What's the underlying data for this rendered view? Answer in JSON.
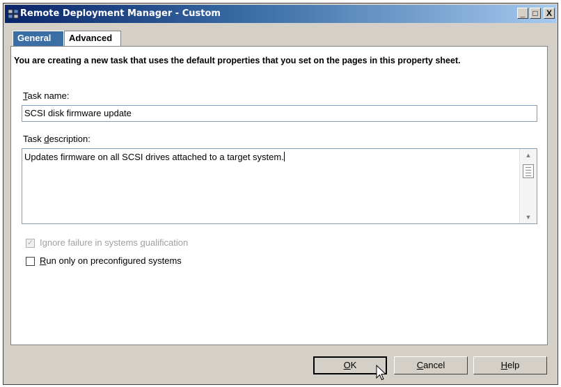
{
  "window": {
    "title": "Remote Deployment Manager - Custom"
  },
  "titlebar_buttons": {
    "minimize": "_",
    "maximize": "□",
    "close": "X"
  },
  "tabs": [
    {
      "label": "General",
      "active": true
    },
    {
      "label": "Advanced",
      "active": false
    }
  ],
  "intro": "You are creating a new task that uses the default properties that you set on the pages in this property sheet.",
  "task_name": {
    "label_prefix": "T",
    "label_rest": "ask name:",
    "value": "SCSI disk firmware update"
  },
  "task_description": {
    "label_prefix": "Task ",
    "label_mnemonic": "d",
    "label_rest": "escription:",
    "value": "Updates firmware on all SCSI drives attached to a target system."
  },
  "options": {
    "ignore_failure": {
      "label_prefix": "Ignore failure in systems ",
      "label_mnemonic": "q",
      "label_rest": "ualification",
      "checked": true,
      "disabled": true
    },
    "run_only": {
      "label_mnemonic": "R",
      "label_rest": "un only on preconfigured systems",
      "checked": false,
      "disabled": false
    }
  },
  "buttons": {
    "ok": {
      "mnemonic": "O",
      "rest": "K"
    },
    "cancel": {
      "mnemonic": "C",
      "rest": "ancel"
    },
    "help": {
      "mnemonic": "H",
      "rest": "elp"
    }
  },
  "colors": {
    "title_start": "#0a246a",
    "title_end": "#a6caf0",
    "active_tab": "#3a6ea5",
    "dialog_bg": "#d4d0c8"
  }
}
